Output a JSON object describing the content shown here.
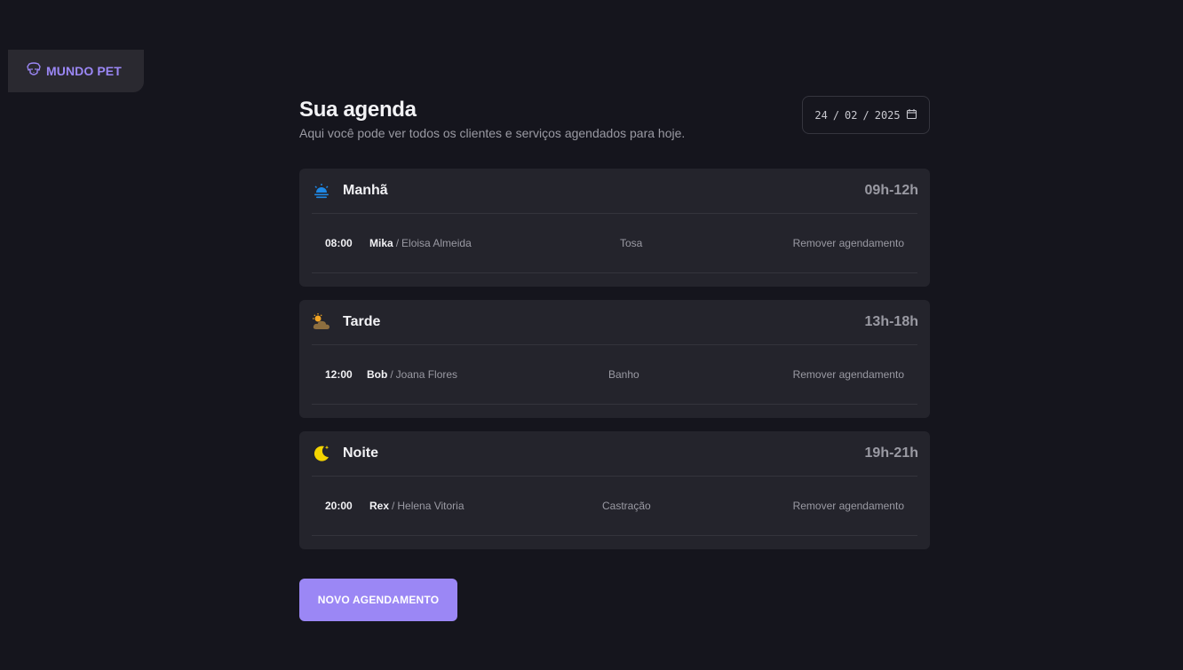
{
  "brand": {
    "name": "MUNDO PET"
  },
  "header": {
    "title": "Sua agenda",
    "subtitle": "Aqui você pode ver todos os clientes e serviços agendados para hoje."
  },
  "date_picker": {
    "day": "24",
    "month": "02",
    "year": "2025"
  },
  "periods": [
    {
      "name": "Manhã",
      "range": "09h-12h",
      "icon": "sunrise-icon",
      "appointment": {
        "time": "08:00",
        "pet": "Mika",
        "owner": "Eloisa Almeida",
        "service": "Tosa",
        "action": "Remover agendamento"
      }
    },
    {
      "name": "Tarde",
      "range": "13h-18h",
      "icon": "cloud-sun-icon",
      "appointment": {
        "time": "12:00",
        "pet": "Bob",
        "owner": "Joana Flores",
        "service": "Banho",
        "action": "Remover agendamento"
      }
    },
    {
      "name": "Noite",
      "range": "19h-21h",
      "icon": "moon-icon",
      "appointment": {
        "time": "20:00",
        "pet": "Rex",
        "owner": "Helena Vitoria",
        "service": "Castração",
        "action": "Remover agendamento"
      }
    }
  ],
  "new_button": {
    "label": "NOVO AGENDAMENTO"
  },
  "colors": {
    "background": "#15151d",
    "card": "#24242c",
    "accent": "#9b87f5",
    "muted_text": "#9a9aa3"
  }
}
